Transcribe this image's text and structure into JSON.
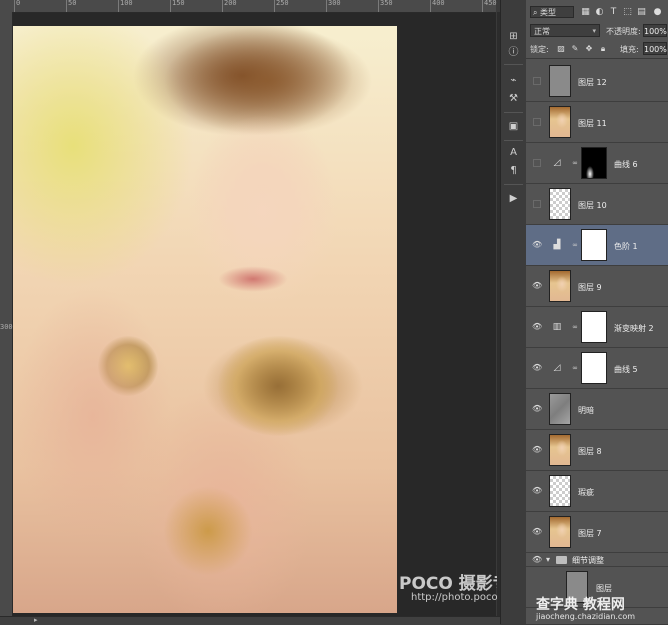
{
  "rulers": {
    "top_labels": [
      "0",
      "50",
      "100",
      "150",
      "200",
      "250",
      "300",
      "350",
      "400",
      "450"
    ],
    "left_label": "300"
  },
  "toolstrip": {
    "icons": [
      "history-icon",
      "info-icon",
      "brush-icon",
      "tool-presets-icon",
      "character-icon",
      "paragraph-icon",
      "actions-icon"
    ]
  },
  "layers_panel": {
    "kind_filter": "类型",
    "blend_mode": "正常",
    "opacity_label": "不透明度:",
    "opacity_value": "100%",
    "lock_label": "锁定:",
    "fill_label": "填充:",
    "fill_value": "100%",
    "layers": [
      {
        "name": "图层 12",
        "thumb": "gray",
        "visible": false,
        "selected": false
      },
      {
        "name": "图层 11",
        "thumb": "photo",
        "visible": false,
        "selected": false
      },
      {
        "name": "曲线 6",
        "thumb": "curves-icon",
        "mask": "dark",
        "visible": false,
        "selected": false
      },
      {
        "name": "图层 10",
        "thumb": "transparent",
        "visible": false,
        "selected": false
      },
      {
        "name": "色阶 1",
        "thumb": "levels-icon",
        "mask": "white",
        "visible": true,
        "selected": true
      },
      {
        "name": "图层 9",
        "thumb": "photo",
        "visible": true,
        "selected": false
      },
      {
        "name": "渐变映射 2",
        "thumb": "gradient-map-icon",
        "mask": "white",
        "visible": true,
        "selected": false
      },
      {
        "name": "曲线 5",
        "thumb": "curves-icon",
        "mask": "white",
        "visible": true,
        "selected": false
      },
      {
        "name": "明暗",
        "thumb": "texture",
        "visible": true,
        "selected": false
      },
      {
        "name": "图层 8",
        "thumb": "photo",
        "visible": true,
        "selected": false
      },
      {
        "name": "瑕疵",
        "thumb": "transparent",
        "visible": true,
        "selected": false
      },
      {
        "name": "图层 7",
        "thumb": "photo",
        "visible": true,
        "selected": false
      }
    ],
    "group": {
      "name": "细节调整",
      "expanded": true
    },
    "partial_layer_name": "图层"
  },
  "watermarks": {
    "poco": "POCO 摄影专题",
    "poco_url": "http://photo.poco.cn",
    "site": "查字典 教程网",
    "site_url": "jiaocheng.chazidian.com"
  }
}
